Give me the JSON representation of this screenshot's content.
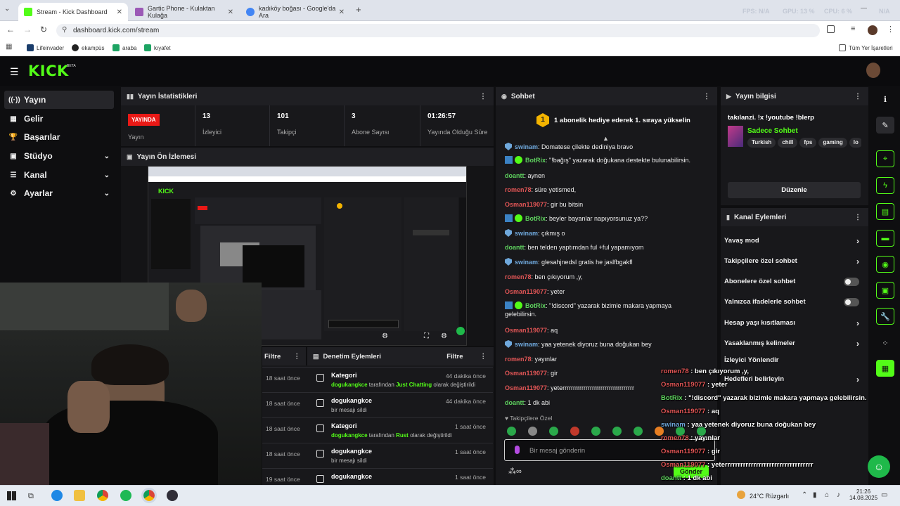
{
  "browser": {
    "tabs": [
      {
        "title": "Stream - Kick Dashboard",
        "active": true
      },
      {
        "title": "Gartic Phone - Kulaktan Kulağa",
        "active": false
      },
      {
        "title": "kadıköy boğası - Google'da Ara",
        "active": false
      }
    ],
    "url": "dashboard.kick.com/stream",
    "perf": {
      "fps": "FPS: N/A",
      "gpu": "GPU: 13 %",
      "cpu": "CPU: 6 %",
      "na": "N/A"
    },
    "bookmarks": [
      "Lifeinvader",
      "ekampüs",
      "araba",
      "kıyafet"
    ],
    "all_bookmarks": "Tüm Yer İşaretleri"
  },
  "kick": {
    "logo": "KICK",
    "beta": "BETA",
    "nav": [
      {
        "label": "Yayın",
        "icon": "((·))"
      },
      {
        "label": "Gelir",
        "icon": "▦"
      },
      {
        "label": "Başarılar",
        "icon": "🏆"
      },
      {
        "label": "Stüdyo",
        "icon": "▣"
      },
      {
        "label": "Kanal",
        "icon": "☰"
      },
      {
        "label": "Ayarlar",
        "icon": "⚙"
      }
    ],
    "stats": {
      "title": "Yayın İstatistikleri",
      "badge": "YAYINDA",
      "badge_label": "Yayın",
      "items": [
        {
          "value": "13",
          "label": "İzleyici"
        },
        {
          "value": "101",
          "label": "Takipçi"
        },
        {
          "value": "3",
          "label": "Abone Sayısı"
        },
        {
          "value": "01:26:57",
          "label": "Yayında Olduğu Süre"
        }
      ]
    },
    "preview": {
      "title": "Yayın Ön İzlemesi"
    },
    "audit_filter_left": "Filtre",
    "audit": {
      "title": "Denetim Eylemleri",
      "filter": "Filtre",
      "rows": [
        {
          "time": "18 saat önce",
          "action": "Kategori",
          "user": "dogukangkce",
          "detail": " tarafından ",
          "highlight": "Just Chatting",
          "suffix": " olarak değiştirildi",
          "ago": "44 dakika önce"
        },
        {
          "time": "18 saat önce",
          "action": "dogukangkce",
          "user": "",
          "detail": "bir mesajı sildi",
          "highlight": "",
          "suffix": "",
          "ago": "44 dakika önce"
        },
        {
          "time": "18 saat önce",
          "action": "Kategori",
          "user": "dogukangkce",
          "detail": " tarafından ",
          "highlight": "Rust",
          "suffix": " olarak değiştirildi",
          "ago": "1 saat önce"
        },
        {
          "time": "18 saat önce",
          "action": "dogukangkce",
          "user": "",
          "detail": "bir mesajı sildi",
          "highlight": "",
          "suffix": "",
          "ago": "1 saat önce"
        },
        {
          "time": "19 saat önce",
          "action": "dogukangkce",
          "user": "",
          "detail": "",
          "highlight": "",
          "suffix": "",
          "ago": "1 saat önce"
        }
      ]
    },
    "chat": {
      "title": "Sohbet",
      "pinned_num": "1",
      "pinned": "1 abonelik hediye ederek 1. sıraya yükselin",
      "messages": [
        {
          "user": "swinam",
          "color": "#6fa8dc",
          "text": "Domatese çilekte dediniya bravo"
        },
        {
          "user": "BotRix",
          "color": "#5fd35f",
          "text": "\"!bağış\" yazarak doğukana destekte bulunabilirsin."
        },
        {
          "user": "doantt",
          "color": "#5fd35f",
          "text": "aynen"
        },
        {
          "user": "romen78",
          "color": "#e05555",
          "text": "süre yetismed,"
        },
        {
          "user": "Osman119077",
          "color": "#e05555",
          "text": "gir bu bitsin"
        },
        {
          "user": "BotRix",
          "color": "#5fd35f",
          "text": "beyler bayanlar napıyorsunuz ya??"
        },
        {
          "user": "swinam",
          "color": "#6fa8dc",
          "text": "çıkmış o"
        },
        {
          "user": "doantt",
          "color": "#5fd35f",
          "text": "ben telden yaptımdan ful +ful yapamıyom"
        },
        {
          "user": "swinam",
          "color": "#6fa8dc",
          "text": "glesahjnedsl gratis he jaslfbgakfl"
        },
        {
          "user": "romen78",
          "color": "#e05555",
          "text": "ben çıkıyorum ,y,"
        },
        {
          "user": "Osman119077",
          "color": "#e05555",
          "text": "yeter"
        },
        {
          "user": "BotRix",
          "color": "#5fd35f",
          "text": "\"!discord\" yazarak bizimle makara yapmaya gelebilirsin."
        },
        {
          "user": "Osman119077",
          "color": "#e05555",
          "text": "aq"
        },
        {
          "user": "swinam",
          "color": "#6fa8dc",
          "text": "yaa yetenek diyoruz buna doğukan bey"
        },
        {
          "user": "romen78",
          "color": "#e05555",
          "text": "yayınlar"
        },
        {
          "user": "Osman119077",
          "color": "#e05555",
          "text": "gir"
        },
        {
          "user": "Osman119077",
          "color": "#e05555",
          "text": "yeterrrrrrrrrrrrrrrrrrrrrrrrrrrrrrrrrr"
        },
        {
          "user": "doantt",
          "color": "#5fd35f",
          "text": "1 dk abi"
        }
      ],
      "followers_only": "Takipçilere Özel",
      "input_placeholder": "Bir mesaj gönderin",
      "send": "Gönder"
    },
    "info": {
      "title": "Yayın bilgisi",
      "stream_title": "takılanzi. !x !youtube !blerp",
      "category": "Sadece Sohbet",
      "tags": [
        "Turkish",
        "chill",
        "fps",
        "gaming",
        "lo"
      ],
      "edit": "Düzenle"
    },
    "channel_actions": {
      "title": "Kanal Eylemleri",
      "items": [
        {
          "label": "Yavaş mod",
          "type": "chevron"
        },
        {
          "label": "Takipçilere özel sohbet",
          "type": "chevron"
        },
        {
          "label": "Abonelere özel sohbet",
          "type": "toggle"
        },
        {
          "label": "Yalnızca ifadelerle sohbet",
          "type": "toggle"
        },
        {
          "label": "Hesap yaşı kısıtlaması",
          "type": "chevron"
        },
        {
          "label": "Yasaklanmış kelimeler",
          "type": "chevron"
        },
        {
          "label": "İzleyici Yönlendir",
          "type": "none"
        },
        {
          "label": "Hedefleri belirleyin",
          "type": "chevron"
        }
      ]
    },
    "overlay_chat": [
      {
        "user": "romen78",
        "color": "#e05555",
        "text": " : ben çıkıyorum ,y,"
      },
      {
        "user": "Osman119077",
        "color": "#e05555",
        "text": " : yeter"
      },
      {
        "user": "BotRix",
        "color": "#5fd35f",
        "text": " : \"!discord\" yazarak bizimle makara yapmaya gelebilirsin."
      },
      {
        "user": "Osman119077",
        "color": "#e05555",
        "text": " : aq"
      },
      {
        "user": "swinam",
        "color": "#6fa8dc",
        "text": " : yaa yetenek diyoruz buna doğukan bey"
      },
      {
        "user": "romen78",
        "color": "#e05555",
        "text": " : yayınlar"
      },
      {
        "user": "Osman119077",
        "color": "#e05555",
        "text": " : gir"
      },
      {
        "user": "Osman119077",
        "color": "#e05555",
        "text": " : yeterrrrrrrrrrrrrrrrrrrrrrrrrrrrrrrrrr"
      },
      {
        "user": "doantt",
        "color": "#5fd35f",
        "text": " : 1 dk abi"
      }
    ]
  },
  "taskbar": {
    "weather": "24°C  Rüzgarlı",
    "time": "21:26",
    "date": "14.08.2025"
  },
  "colors": {
    "kick_green": "#53fc18",
    "live_red": "#e91916"
  }
}
